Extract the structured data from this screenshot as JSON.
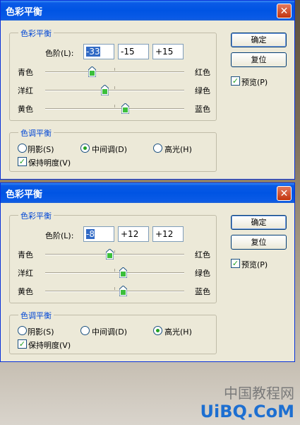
{
  "dialogs": [
    {
      "title": "色彩平衡",
      "close": "✕",
      "color_balance": {
        "group_title": "色彩平衡",
        "levels_label": "色阶(L):",
        "levels": [
          "-33",
          "-15",
          "+15"
        ],
        "sliders": [
          {
            "left": "青色",
            "right": "红色",
            "value": -33
          },
          {
            "left": "洋红",
            "right": "绿色",
            "value": -15
          },
          {
            "left": "黄色",
            "right": "蓝色",
            "value": 15
          }
        ]
      },
      "tone_balance": {
        "group_title": "色调平衡",
        "shadows": "阴影(S)",
        "midtones": "中间调(D)",
        "highlights": "高光(H)",
        "selected": "midtones",
        "preserve": "保持明度(V)",
        "preserve_checked": true
      },
      "buttons": {
        "ok": "确定",
        "reset": "复位"
      },
      "preview": {
        "label": "预览(P)",
        "checked": true
      }
    },
    {
      "title": "色彩平衡",
      "close": "✕",
      "color_balance": {
        "group_title": "色彩平衡",
        "levels_label": "色阶(L):",
        "levels": [
          "-8",
          "+12",
          "+12"
        ],
        "sliders": [
          {
            "left": "青色",
            "right": "红色",
            "value": -8
          },
          {
            "left": "洋红",
            "right": "绿色",
            "value": 12
          },
          {
            "left": "黄色",
            "right": "蓝色",
            "value": 12
          }
        ]
      },
      "tone_balance": {
        "group_title": "色调平衡",
        "shadows": "阴影(S)",
        "midtones": "中间调(D)",
        "highlights": "高光(H)",
        "selected": "highlights",
        "preserve": "保持明度(V)",
        "preserve_checked": true
      },
      "buttons": {
        "ok": "确定",
        "reset": "复位"
      },
      "preview": {
        "label": "预览(P)",
        "checked": true
      }
    }
  ],
  "watermark": {
    "line1": "中国教程网",
    "line2": "UiBQ.CoM"
  }
}
